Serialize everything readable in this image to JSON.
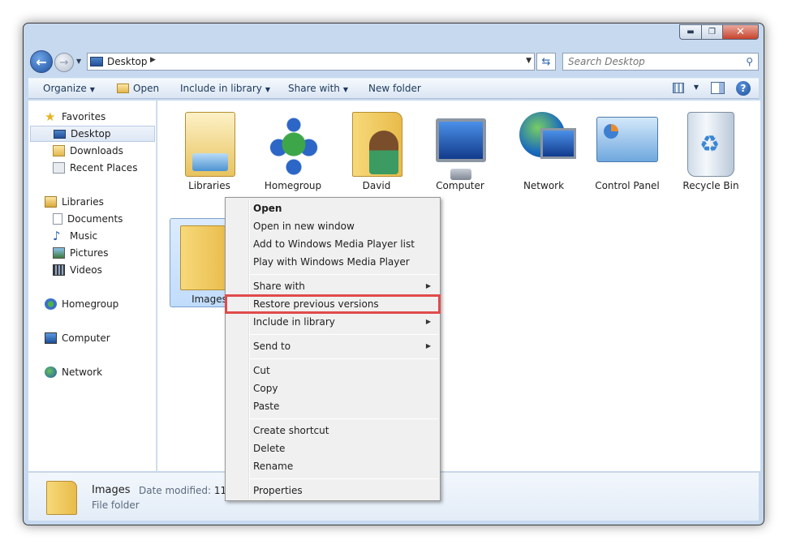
{
  "window": {
    "controls": {
      "minimize": "▬",
      "maximize": "❐",
      "close": "✕"
    }
  },
  "address": {
    "location": "Desktop",
    "search_placeholder": "Search Desktop"
  },
  "toolbar": {
    "organize": "Organize",
    "open": "Open",
    "include_in_library": "Include in library",
    "share_with": "Share with",
    "new_folder": "New folder",
    "help": "?"
  },
  "nav": {
    "favorites": "Favorites",
    "desktop": "Desktop",
    "downloads": "Downloads",
    "recent_places": "Recent Places",
    "libraries": "Libraries",
    "documents": "Documents",
    "music": "Music",
    "pictures": "Pictures",
    "videos": "Videos",
    "homegroup": "Homegroup",
    "computer": "Computer",
    "network": "Network"
  },
  "desktop_items": {
    "libraries": "Libraries",
    "homegroup": "Homegroup",
    "david": "David",
    "computer": "Computer",
    "network": "Network",
    "control_panel": "Control Panel",
    "recycle_bin": "Recycle Bin",
    "images": "Images"
  },
  "context_menu": {
    "open": "Open",
    "open_new_window": "Open in new window",
    "add_wmp_list": "Add to Windows Media Player list",
    "play_wmp": "Play with Windows Media Player",
    "share_with": "Share with",
    "restore_previous": "Restore previous versions",
    "include_in_library": "Include in library",
    "send_to": "Send to",
    "cut": "Cut",
    "copy": "Copy",
    "paste": "Paste",
    "create_shortcut": "Create shortcut",
    "delete": "Delete",
    "rename": "Rename",
    "properties": "Properties",
    "highlight_color": "#e04b4b"
  },
  "details": {
    "name": "Images",
    "date_label": "Date modified:",
    "date_value": "11/2",
    "type": "File folder"
  },
  "colors": {
    "frame": "#c6d9ef",
    "toolbar_text": "#1e395b",
    "selection": "#c1dcfc"
  }
}
